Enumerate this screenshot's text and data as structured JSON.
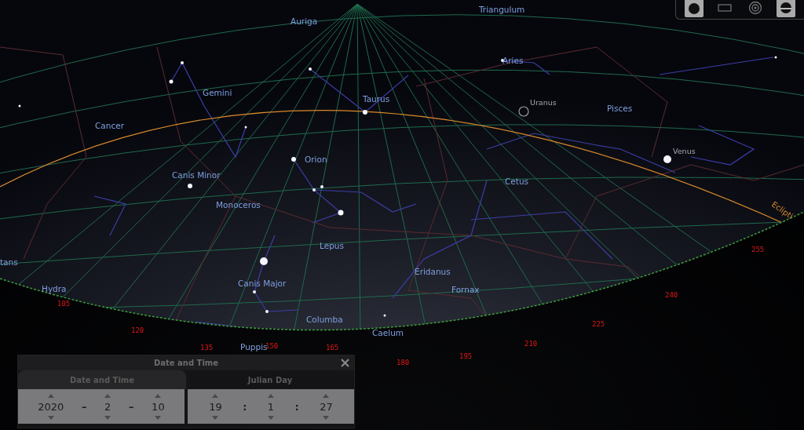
{
  "sky_labels": [
    {
      "text": "Auriga",
      "kind": "constellation"
    },
    {
      "text": "Triangulum",
      "kind": "constellation"
    },
    {
      "text": "Aries",
      "kind": "constellation"
    },
    {
      "text": "Gemini",
      "kind": "constellation"
    },
    {
      "text": "Taurus",
      "kind": "constellation"
    },
    {
      "text": "Uranus",
      "kind": "planet"
    },
    {
      "text": "Pisces",
      "kind": "constellation"
    },
    {
      "text": "Cancer",
      "kind": "constellation"
    },
    {
      "text": "Venus",
      "kind": "planet"
    },
    {
      "text": "Orion",
      "kind": "constellation"
    },
    {
      "text": "Canis Minor",
      "kind": "constellation"
    },
    {
      "text": "Cetus",
      "kind": "constellation"
    },
    {
      "text": "Monoceros",
      "kind": "constellation"
    },
    {
      "text": "Lepus",
      "kind": "constellation"
    },
    {
      "text": "tans",
      "kind": "constellation"
    },
    {
      "text": "Hydra",
      "kind": "constellation"
    },
    {
      "text": "Canis Major",
      "kind": "constellation"
    },
    {
      "text": "Eridanus",
      "kind": "constellation"
    },
    {
      "text": "Fornax",
      "kind": "constellation"
    },
    {
      "text": "Columba",
      "kind": "constellation"
    },
    {
      "text": "Caelum",
      "kind": "constellation"
    },
    {
      "text": "Puppis",
      "kind": "constellation"
    },
    {
      "text": "Eclipti",
      "kind": "line"
    }
  ],
  "azimuth_marks": [
    "105",
    "120",
    "135",
    "150",
    "165",
    "180",
    "195",
    "210",
    "225",
    "240",
    "255"
  ],
  "toolbar": {
    "buttons": [
      {
        "kind": "disk",
        "on": true
      },
      {
        "kind": "frame",
        "on": false
      },
      {
        "kind": "rings",
        "on": false
      },
      {
        "kind": "halfdisk",
        "on": true
      }
    ]
  },
  "dialog": {
    "title": "Date and Time",
    "tabs": [
      {
        "label": "Date and Time",
        "selected": true
      },
      {
        "label": "Julian Day",
        "selected": false
      }
    ],
    "groups": [
      [
        {
          "kind": "value",
          "text": "2020"
        },
        {
          "kind": "separator",
          "text": "–"
        },
        {
          "kind": "value",
          "text": "2"
        },
        {
          "kind": "separator",
          "text": "–"
        },
        {
          "kind": "value",
          "text": "10"
        }
      ],
      [
        {
          "kind": "value",
          "text": "19"
        },
        {
          "kind": "separator",
          "text": ":"
        },
        {
          "kind": "value",
          "text": "1"
        },
        {
          "kind": "separator",
          "text": ":"
        },
        {
          "kind": "value",
          "text": "27"
        }
      ]
    ]
  }
}
